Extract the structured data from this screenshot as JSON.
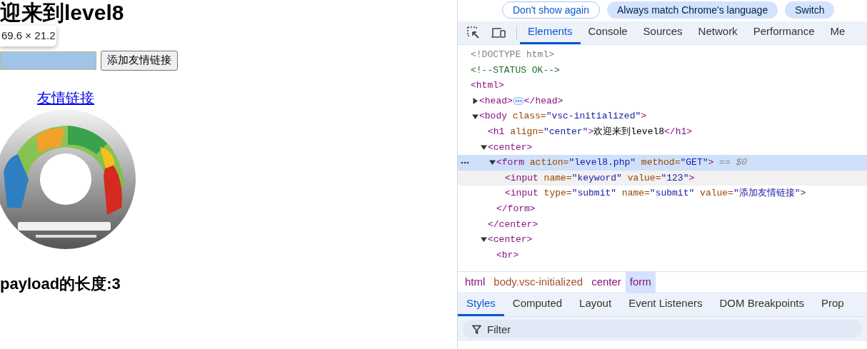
{
  "page": {
    "heading": "迎来到level8",
    "size_tooltip": "69.6 × 21.2",
    "keyword_field": {
      "highlighted": true
    },
    "submit_button": "添加友情链接",
    "link": "友情链接",
    "payload_length": "payload的长度:3"
  },
  "devtools": {
    "infobar_buttons": [
      {
        "label": "Don't show again",
        "kind": "outline"
      },
      {
        "label": "Always match Chrome's language",
        "kind": "filled"
      },
      {
        "label": "Switch",
        "kind": "filled"
      }
    ],
    "tabs": [
      {
        "label": "Elements",
        "selected": true
      },
      {
        "label": "Console",
        "selected": false
      },
      {
        "label": "Sources",
        "selected": false
      },
      {
        "label": "Network",
        "selected": false
      },
      {
        "label": "Performance",
        "selected": false
      },
      {
        "label": "Me",
        "selected": false
      }
    ],
    "dom_tree": [
      {
        "tokens": [
          {
            "kind": "doctype",
            "text": "<!DOCTYPE html>"
          }
        ],
        "selected": false,
        "hovered": false
      },
      {
        "tokens": [
          {
            "kind": "comment",
            "text": "<!--STATUS OK-->"
          }
        ],
        "selected": false,
        "hovered": false
      },
      {
        "tokens": [
          {
            "kind": "tag",
            "text": "<html>"
          }
        ],
        "selected": false,
        "hovered": false,
        "children": [
          {
            "tokens": [
              {
                "kind": "tag",
                "text": "<head>"
              }
            ],
            "closing": [
              {
                "kind": "tag",
                "text": "</head>"
              }
            ],
            "expanded": false,
            "selected": false,
            "hovered": false
          },
          {
            "tokens": [
              {
                "kind": "tag",
                "text": "<body"
              },
              {
                "kind": "attr",
                "text": " class="
              },
              {
                "kind": "value",
                "text": "\"vsc-initialized\""
              },
              {
                "kind": "tag",
                "text": ">"
              }
            ],
            "expanded": true,
            "selected": false,
            "hovered": false,
            "children": [
              {
                "tokens": [
                  {
                    "kind": "tag",
                    "text": "<h1"
                  },
                  {
                    "kind": "attr",
                    "text": " align="
                  },
                  {
                    "kind": "value",
                    "text": "\"center\""
                  },
                  {
                    "kind": "tag",
                    "text": ">"
                  },
                  {
                    "kind": "text",
                    "text": "欢迎来到level8"
                  },
                  {
                    "kind": "tag",
                    "text": "</h1>"
                  }
                ],
                "selected": false,
                "hovered": false
              },
              {
                "tokens": [
                  {
                    "kind": "tag",
                    "text": "<center>"
                  }
                ],
                "expanded": true,
                "selected": false,
                "hovered": false,
                "children": [
                  {
                    "tokens": [
                      {
                        "kind": "tag",
                        "text": "<form"
                      },
                      {
                        "kind": "attr",
                        "text": " action="
                      },
                      {
                        "kind": "value",
                        "text": "\"level8.php\""
                      },
                      {
                        "kind": "attr",
                        "text": " method="
                      },
                      {
                        "kind": "value",
                        "text": "\"GET\""
                      },
                      {
                        "kind": "tag",
                        "text": ">"
                      },
                      {
                        "kind": "console",
                        "text": " == $0"
                      }
                    ],
                    "expanded": true,
                    "selected": true,
                    "hovered": false,
                    "children": [
                      {
                        "tokens": [
                          {
                            "kind": "tag",
                            "text": "<input"
                          },
                          {
                            "kind": "attr",
                            "text": " name="
                          },
                          {
                            "kind": "value",
                            "text": "\"keyword\""
                          },
                          {
                            "kind": "attr",
                            "text": " value="
                          },
                          {
                            "kind": "value",
                            "text": "\"123\""
                          },
                          {
                            "kind": "tag",
                            "text": ">"
                          }
                        ],
                        "selected": false,
                        "hovered": true
                      },
                      {
                        "tokens": [
                          {
                            "kind": "tag",
                            "text": "<input"
                          },
                          {
                            "kind": "attr",
                            "text": " type="
                          },
                          {
                            "kind": "value",
                            "text": "\"submit\""
                          },
                          {
                            "kind": "attr",
                            "text": " name="
                          },
                          {
                            "kind": "value",
                            "text": "\"submit\""
                          },
                          {
                            "kind": "attr",
                            "text": " value="
                          },
                          {
                            "kind": "value",
                            "text": "\"添加友情链接\""
                          },
                          {
                            "kind": "tag",
                            "text": ">"
                          }
                        ],
                        "selected": false,
                        "hovered": false
                      }
                    ]
                  },
                  {
                    "tokens": [
                      {
                        "kind": "tag",
                        "text": "</form>"
                      }
                    ],
                    "selected": false,
                    "hovered": false
                  }
                ]
              },
              {
                "tokens": [
                  {
                    "kind": "tag",
                    "text": "</center>"
                  }
                ],
                "selected": false,
                "hovered": false
              },
              {
                "tokens": [
                  {
                    "kind": "tag",
                    "text": "<center>"
                  }
                ],
                "expanded": true,
                "selected": false,
                "hovered": false,
                "children": [
                  {
                    "tokens": [
                      {
                        "kind": "tag",
                        "text": "<br>"
                      }
                    ],
                    "selected": false,
                    "hovered": false
                  }
                ]
              }
            ]
          }
        ]
      }
    ],
    "breadcrumbs": [
      {
        "label": "html",
        "kind": "tag",
        "selected": false
      },
      {
        "label": "body.vsc-initialized",
        "kind": "class",
        "selected": false
      },
      {
        "label": "center",
        "kind": "tag",
        "selected": false
      },
      {
        "label": "form",
        "kind": "tag",
        "selected": true
      }
    ],
    "style_tabs": [
      {
        "label": "Styles",
        "selected": true
      },
      {
        "label": "Computed",
        "selected": false
      },
      {
        "label": "Layout",
        "selected": false
      },
      {
        "label": "Event Listeners",
        "selected": false
      },
      {
        "label": "DOM Breakpoints",
        "selected": false
      },
      {
        "label": "Prop",
        "selected": false
      }
    ],
    "filter": {
      "placeholder": "Filter"
    }
  }
}
